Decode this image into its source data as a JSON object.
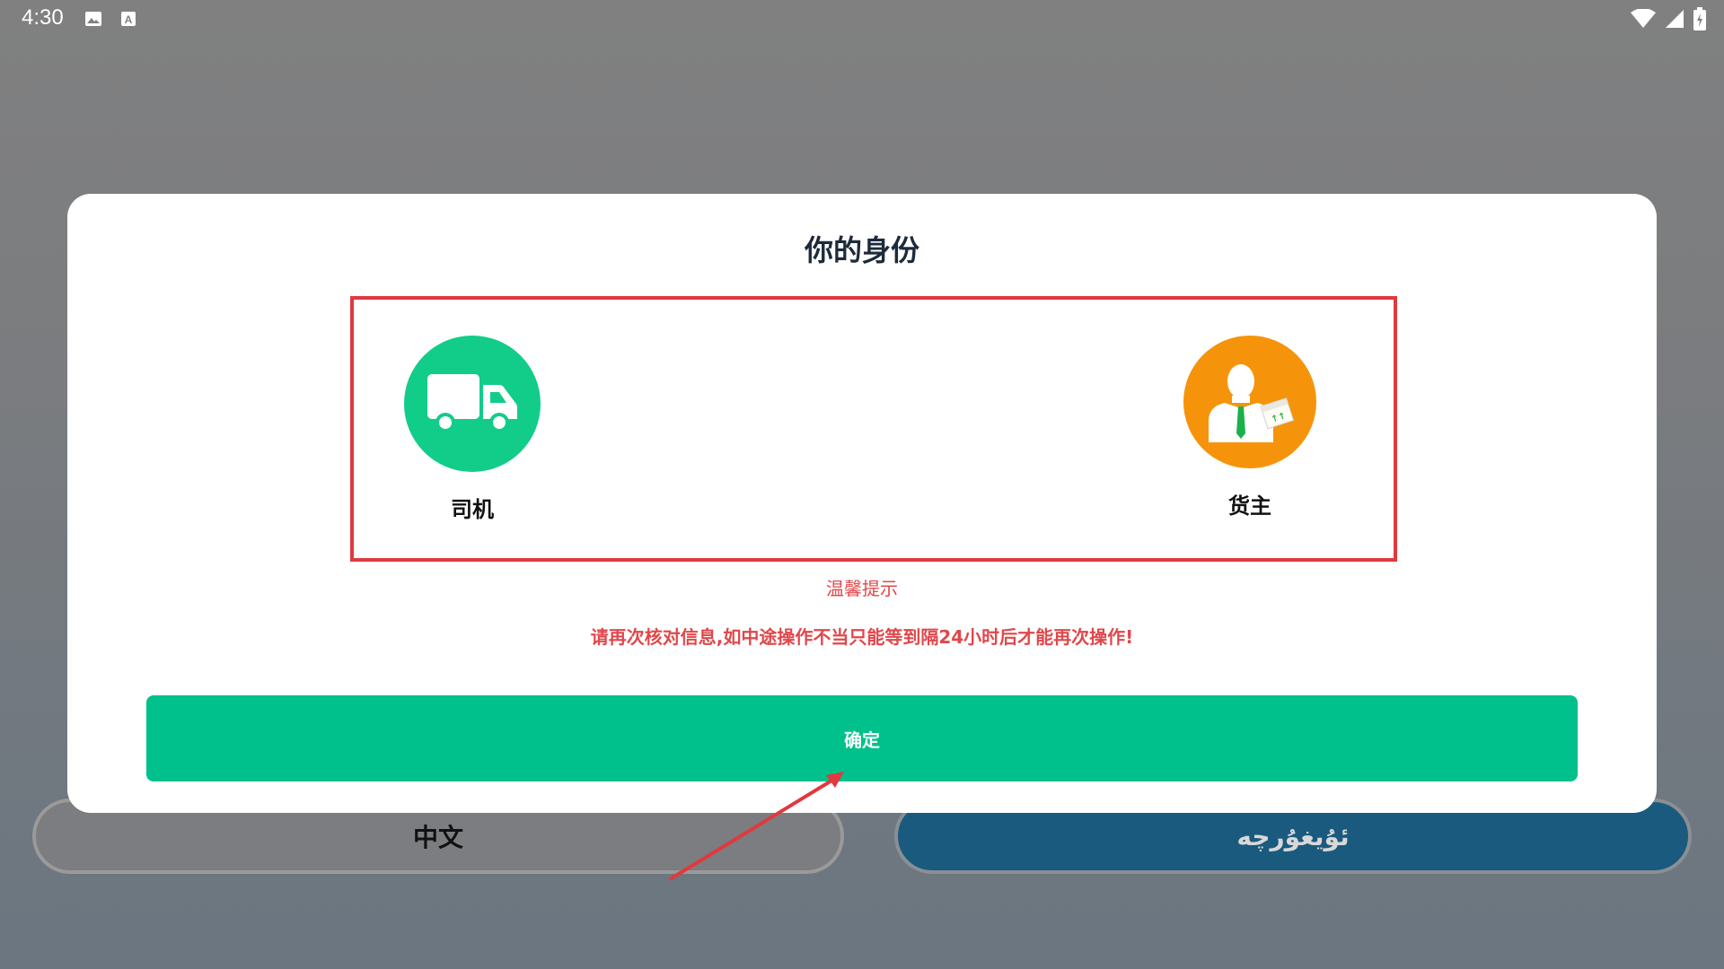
{
  "status_bar": {
    "time": "4:30",
    "left_icons": [
      "image-icon",
      "keyboard-a-icon"
    ],
    "right_icons": [
      "wifi-icon",
      "signal-icon",
      "battery-icon"
    ]
  },
  "background": {
    "lang_zh": "中文",
    "lang_ug": "ئۇيغۇرچە"
  },
  "dialog": {
    "title": "你的身份",
    "roles": [
      {
        "label": "司机",
        "icon": "truck-icon",
        "color": "#12cc8a"
      },
      {
        "label": "货主",
        "icon": "shipper-person-icon",
        "color": "#f5940a"
      }
    ],
    "tip_title": "温馨提示",
    "tip_text": "请再次核对信息,如中途操作不当只能等到隔24小时后才能再次操作!",
    "confirm_label": "确定"
  },
  "colors": {
    "accent": "#00c08b",
    "warning": "#e0474b",
    "highlight_box": "#e0393e"
  }
}
